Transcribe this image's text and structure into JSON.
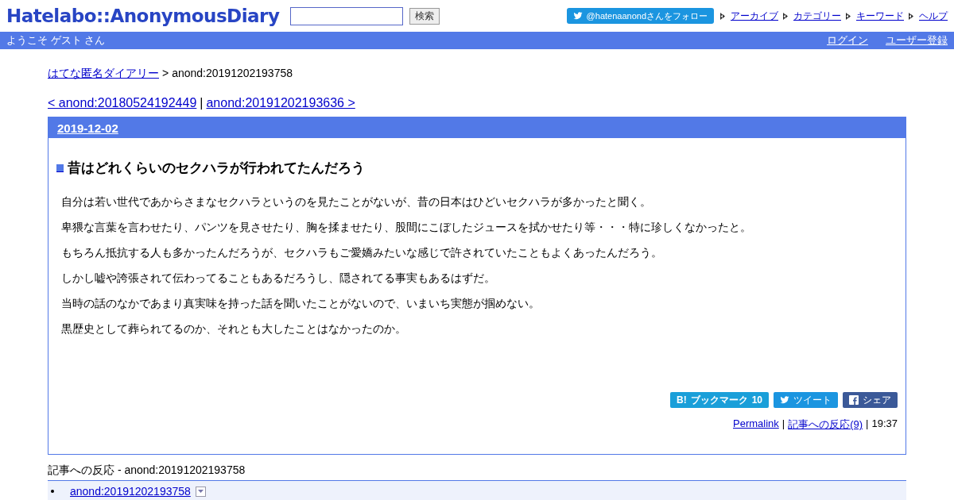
{
  "header": {
    "logo": "Hatelabo::AnonymousDiary",
    "search": {
      "button": "検索"
    },
    "follow_button": "@hatenaanondさんをフォロー",
    "nav_links": [
      "アーカイブ",
      "カテゴリー",
      "キーワード",
      "ヘルプ"
    ]
  },
  "user_bar": {
    "welcome": "ようこそ ゲスト さん",
    "links": [
      "ログイン",
      "ユーザー登録"
    ]
  },
  "breadcrumb": {
    "link": "はてな匿名ダイアリー",
    "separator": ">",
    "current": "anond:20191202193758"
  },
  "pager": {
    "prev": "< anond:20180524192449",
    "separator": "|",
    "next": "anond:20191202193636 >"
  },
  "entry": {
    "date": "2019-12-02",
    "title": "昔はどれくらいのセクハラが行われてたんだろう",
    "paragraphs": [
      "自分は若い世代であからさまなセクハラというのを見たことがないが、昔の日本はひどいセクハラが多かったと聞く。",
      "卑猥な言葉を言わせたり、パンツを見させたり、胸を揉ませたり、股間にこぼしたジュースを拭かせたり等・・・特に珍しくなかったと。",
      "もちろん抵抗する人も多かったんだろうが、セクハラもご愛嬌みたいな感じで許されていたこともよくあったんだろう。",
      "しかし嘘や誇張されて伝わってることもあるだろうし、隠されてる事実もあるはずだ。",
      "当時の話のなかであまり真実味を持った話を聞いたことがないので、いまいち実態が掴めない。",
      "黒歴史として葬られてるのか、それとも大したことはなかったのか。"
    ],
    "share_buttons": [
      {
        "kind": "bookmark",
        "mark": "B!",
        "label": "ブックマーク",
        "count": "10"
      },
      {
        "kind": "tweet",
        "label": "ツイート"
      },
      {
        "kind": "facebook",
        "label": "シェア"
      }
    ],
    "footer": {
      "permalink": "Permalink",
      "reactions": "記事への反応(9)",
      "separator": "|",
      "time": "19:37"
    }
  },
  "reactions": {
    "heading": "記事への反応 - anond:20191202193758",
    "items": [
      {
        "label": "anond:20191202193758"
      }
    ]
  }
}
